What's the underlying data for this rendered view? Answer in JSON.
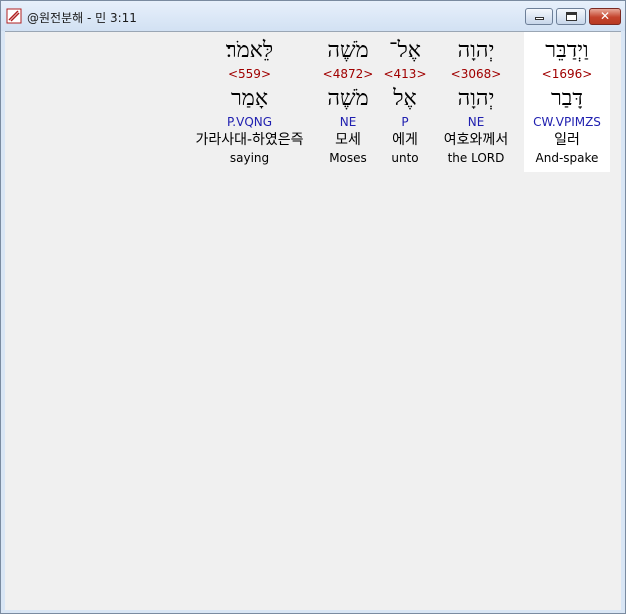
{
  "window": {
    "title": "@원전분해 - 민 3:11",
    "min_label": "",
    "max_label": "",
    "close_label": "✕"
  },
  "words": [
    {
      "hebrew": "וַיְדַבֵּר",
      "strong": "<1696>",
      "root": "דָּבַר",
      "parse": "CW.VPIMZS",
      "korean": "일러",
      "english": "And-spake"
    },
    {
      "hebrew": "יְהוָה",
      "strong": "<3068>",
      "root": "יְהוָה",
      "parse": "NE",
      "korean": "여호와께서",
      "english": "the LORD"
    },
    {
      "hebrew": "אֶל־",
      "strong": "<413>",
      "root": "אֶל",
      "parse": "P",
      "korean": "에게",
      "english": "unto"
    },
    {
      "hebrew": "מֹשֶׁה",
      "strong": "<4872>",
      "root": "מֹשֶׁה",
      "parse": "NE",
      "korean": "모세",
      "english": "Moses"
    },
    {
      "hebrew": "לֵּאמֹר׃",
      "strong": "<559>",
      "root": "אָמַר",
      "parse": "P.VQNG",
      "korean": "가라사대-하였은즉",
      "english": "saying"
    }
  ],
  "colors": {
    "strong": "#a00000",
    "parse": "#2020b0",
    "selected_bg": "#ffffff"
  }
}
